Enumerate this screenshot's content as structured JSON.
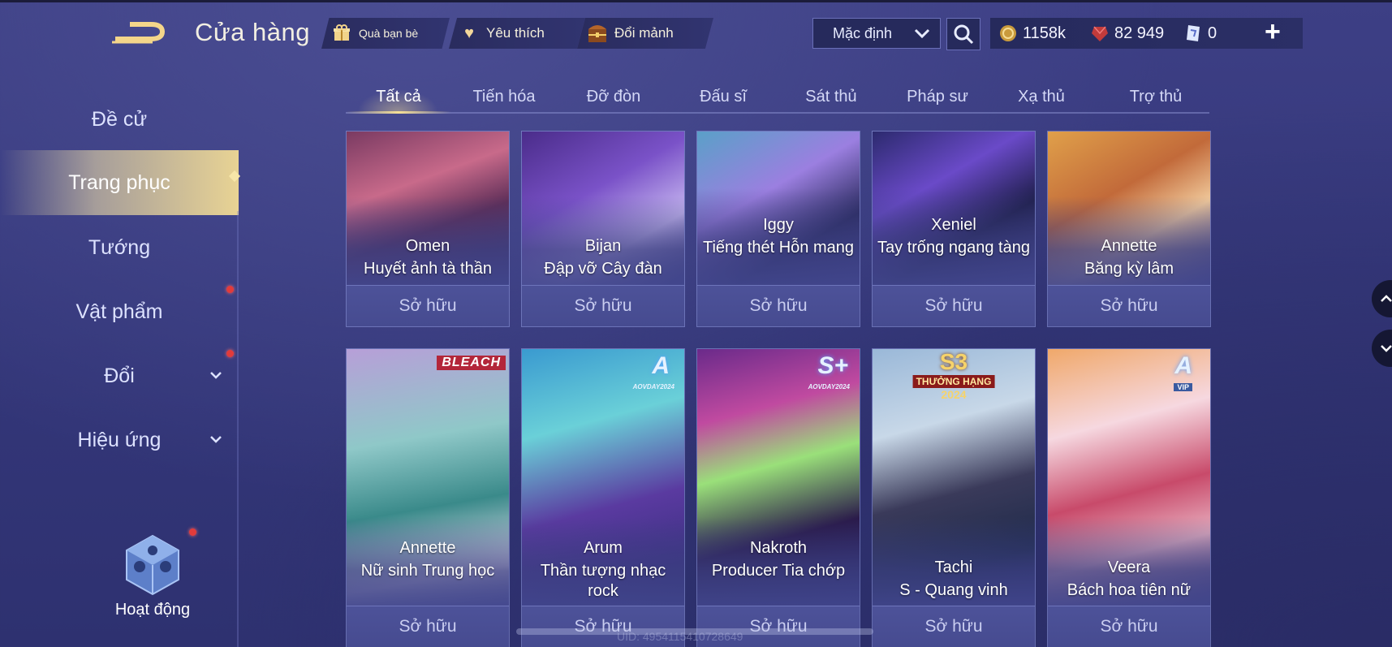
{
  "header": {
    "title": "Cửa hàng",
    "gift_label": "Quà bạn bè",
    "favorite_label": "Yêu thích",
    "shard_label": "Đổi mảnh",
    "sort_value": "Mặc định",
    "currency_gold": "1158k",
    "currency_gem": "82 949",
    "currency_voucher": "0"
  },
  "sidebar": {
    "items": [
      {
        "label": "Đề cử"
      },
      {
        "label": "Trang phục"
      },
      {
        "label": "Tướng"
      },
      {
        "label": "Vật phẩm"
      },
      {
        "label": "Đổi"
      },
      {
        "label": "Hiệu ứng"
      }
    ],
    "active_index": 1,
    "activity_label": "Hoạt động"
  },
  "tabs": [
    "Tất cả",
    "Tiến hóa",
    "Đỡ đòn",
    "Đấu sĩ",
    "Sát thủ",
    "Pháp sư",
    "Xạ thủ",
    "Trợ thủ"
  ],
  "cards_row1": [
    {
      "hero": "Omen",
      "skin": "Huyết ảnh tà thần",
      "status": "Sở hữu"
    },
    {
      "hero": "Bijan",
      "skin": "Đập vỡ Cây đàn",
      "status": "Sở hữu"
    },
    {
      "hero": "Iggy",
      "skin": "Tiếng thét Hỗn mang",
      "status": "Sở hữu"
    },
    {
      "hero": "Xeniel",
      "skin": "Tay trống ngang tàng",
      "status": "Sở hữu"
    },
    {
      "hero": "Annette",
      "skin": "Băng kỳ lâm",
      "status": "Sở hữu"
    }
  ],
  "cards_row2": [
    {
      "hero": "Annette",
      "skin": "Nữ sinh Trung học",
      "status": "Sở hữu",
      "badge": "BLEACH"
    },
    {
      "hero": "Arum",
      "skin": "Thần tượng nhạc rock",
      "status": "Sở hữu",
      "badge": "A",
      "badge_sub": "AOVDAY2024"
    },
    {
      "hero": "Nakroth",
      "skin": "Producer Tia chớp",
      "status": "Sở hữu",
      "badge": "S+",
      "badge_sub": "AOVDAY2024"
    },
    {
      "hero": "Tachi",
      "skin": "S - Quang vinh",
      "status": "Sở hữu",
      "badge": "S3",
      "badge_sub": "THƯỞNG HẠNG",
      "badge_year": "2024"
    },
    {
      "hero": "Veera",
      "skin": "Bách hoa tiên nữ",
      "status": "Sở hữu",
      "badge": "A",
      "badge_sub": "VIP"
    }
  ],
  "footer": {
    "uid": "UID: 4954115410728649"
  },
  "colors": {
    "accent_gold": "#f6e096",
    "card_footer": "#4d5299",
    "notification": "#e23b3b"
  }
}
